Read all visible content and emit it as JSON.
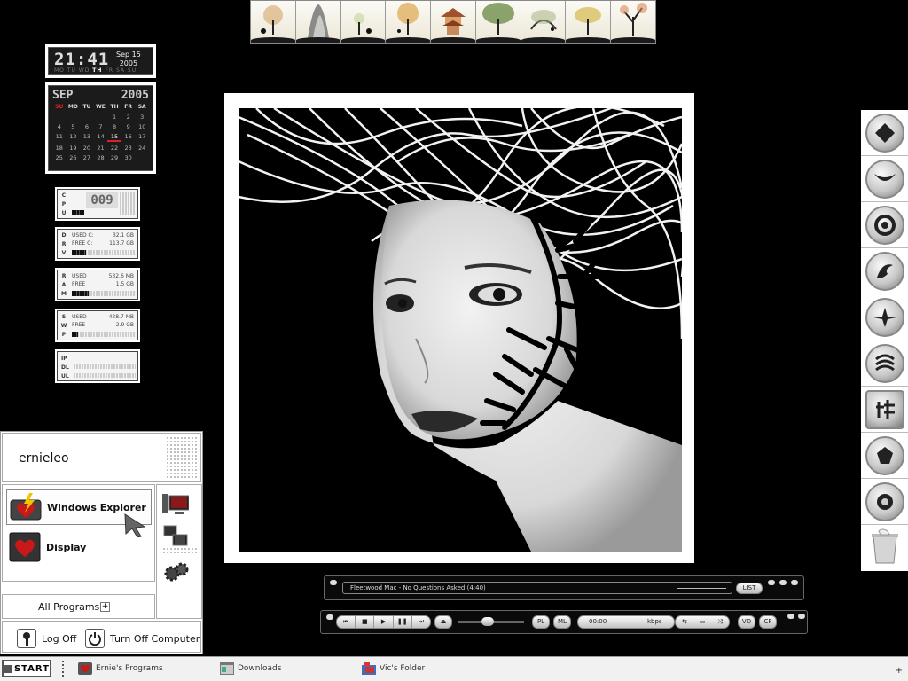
{
  "clock": {
    "time": "21:41",
    "month_day": "Sep 15",
    "year": "2005",
    "days": [
      "MO",
      "TU",
      "WD",
      "TH",
      "FR",
      "SA",
      "SU"
    ],
    "current_day": "TH"
  },
  "calendar": {
    "month": "SEP",
    "year": "2005",
    "weekdays": [
      "SU",
      "MO",
      "TU",
      "WE",
      "TH",
      "FR",
      "SA"
    ],
    "days": [
      "",
      "",
      "",
      "",
      "1",
      "2",
      "3",
      "4",
      "5",
      "6",
      "7",
      "8",
      "9",
      "10",
      "11",
      "12",
      "13",
      "14",
      "15",
      "16",
      "17",
      "18",
      "19",
      "20",
      "21",
      "22",
      "23",
      "24",
      "25",
      "26",
      "27",
      "28",
      "29",
      "30",
      ""
    ],
    "today": "15"
  },
  "meters": {
    "cpu": {
      "label": "CPU",
      "value": "009",
      "percent": 9
    },
    "drive": {
      "label": "DRV",
      "used_label": "USED C:",
      "used": "32.1 GB",
      "free_label": "FREE C:",
      "free": "113.7 GB",
      "percent": 22
    },
    "ram": {
      "label": "RAM",
      "used_label": "USED",
      "used": "532.6 MB",
      "free_label": "FREE",
      "free": "1.5 GB",
      "percent": 26
    },
    "swap": {
      "label": "SWP",
      "used_label": "USED",
      "used": "428.7 MB",
      "free_label": "FREE",
      "free": "2.9 GB",
      "percent": 10
    },
    "net": {
      "ip_label": "IP",
      "dl_label": "DL",
      "ul_label": "UL"
    }
  },
  "dock": {
    "items": [
      "emblem-icon-1",
      "emblem-icon-2",
      "emblem-icon-3",
      "emblem-icon-4",
      "emblem-icon-5",
      "emblem-icon-6",
      "emblem-icon-7",
      "emblem-icon-8",
      "emblem-icon-9",
      "recycle-bin-icon"
    ]
  },
  "player": {
    "track": "Fleetwood Mac - No Questions Asked (4:40)",
    "list_label": "LIST",
    "transport": [
      "⏮",
      "■",
      "▶",
      "❚❚",
      "⏭"
    ],
    "eject": "⏏",
    "pl_label": "PL",
    "ml_label": "ML",
    "time": "00:00",
    "kbps_label": "kbps",
    "vd_label": "VD",
    "cf_label": "CF",
    "volume": 0.45
  },
  "start_menu": {
    "user": "ernieleo",
    "items": [
      {
        "label": "Windows Explorer",
        "icon": "explorer-icon"
      },
      {
        "label": "Display",
        "icon": "display-icon"
      }
    ],
    "all_programs": "All Programs",
    "log_off": "Log Off",
    "turn_off": "Turn Off Computer"
  },
  "taskbar": {
    "start": "START",
    "items": [
      {
        "label": "Ernie's Programs",
        "icon": "programs-icon"
      },
      {
        "label": "Downloads",
        "icon": "window-icon"
      },
      {
        "label": "Vic's Folder",
        "icon": "folder-icon"
      }
    ]
  },
  "colors": {
    "background": "#000000",
    "panel": "#ffffff",
    "accent": "#d22222"
  }
}
